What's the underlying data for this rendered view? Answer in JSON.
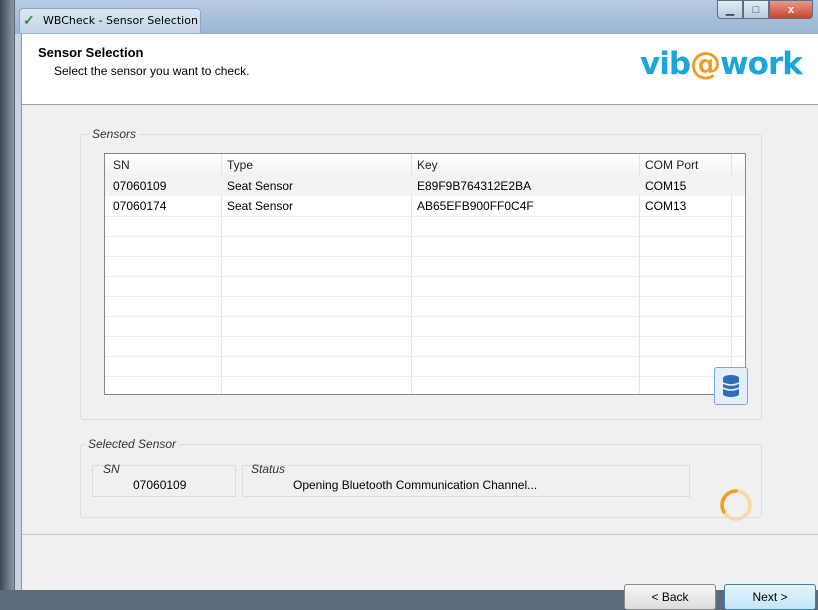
{
  "window": {
    "title": "WBCheck - Sensor Selection",
    "minimize_glyph": "▁",
    "maximize_glyph": "□",
    "close_glyph": "x"
  },
  "header": {
    "title": "Sensor Selection",
    "subtitle": "Select the sensor you want to check.",
    "logo_prefix": "vib",
    "logo_at": "@",
    "logo_suffix": "work"
  },
  "sensors": {
    "group_title": "Sensors",
    "columns": [
      "SN",
      "Type",
      "Key",
      "COM Port"
    ],
    "rows": [
      {
        "sn": "07060109",
        "type": "Seat Sensor",
        "key": "E89F9B764312E2BA",
        "com": "COM15"
      },
      {
        "sn": "07060174",
        "type": "Seat Sensor",
        "key": "AB65EFB900FF0C4F",
        "com": "COM13"
      }
    ],
    "selected_row": 0
  },
  "selected_sensor": {
    "group_title": "Selected Sensor",
    "sn_label": "SN",
    "sn_value": "07060109",
    "status_label": "Status",
    "status_value": "Opening Bluetooth Communication Channel..."
  },
  "buttons": {
    "back": "< Back",
    "next": "Next >"
  },
  "colors": {
    "logo_blue": "#1aa6d9",
    "logo_orange": "#f19c1f",
    "spinner": "#f0a020"
  },
  "icons": {
    "database": "database-icon",
    "spinner": "loading-spinner-icon",
    "app": "app-icon"
  }
}
